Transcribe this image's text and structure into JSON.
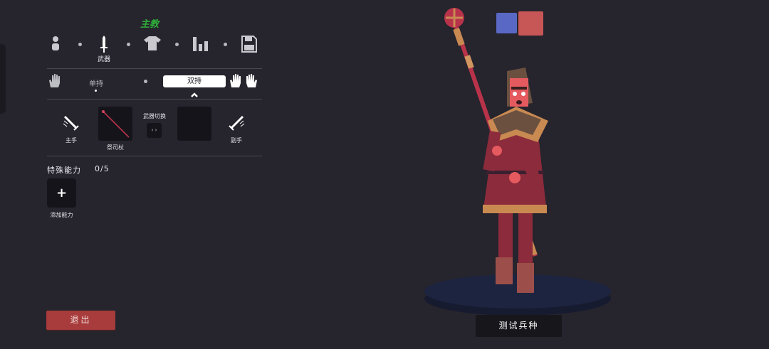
{
  "panel": {
    "title": "主教",
    "categories": [
      {
        "name": "body",
        "icon": "person-icon",
        "label": ""
      },
      {
        "name": "weapon",
        "icon": "sword-icon",
        "label": "武器"
      },
      {
        "name": "clothing",
        "icon": "shirt-icon",
        "label": ""
      },
      {
        "name": "stats",
        "icon": "bar-chart-icon",
        "label": ""
      },
      {
        "name": "save",
        "icon": "floppy-disk-icon",
        "label": ""
      }
    ],
    "grip": {
      "one_handed_label": "单持",
      "two_handed_label": "双持",
      "selected": "two_handed"
    },
    "weapons": {
      "main_hand_label": "主手",
      "off_hand_label": "副手",
      "main_slot_label": "祭司杖",
      "swap_label": "武器切换",
      "swap_symbol": "‹ ›"
    },
    "abilities": {
      "label": "特殊能力",
      "count": "0/5",
      "add_symbol": "+",
      "add_label": "添加能力"
    },
    "exit_label": "退出"
  },
  "preview": {
    "team_colors": [
      "#5a68c5",
      "#c75656"
    ],
    "unit_name": "测试兵种",
    "character_colors": {
      "robe": "#8c2b3b",
      "trim": "#c98a52",
      "skin": "#e55a5e",
      "staff": "#b8334a",
      "pedestal": "#1d2440"
    }
  }
}
